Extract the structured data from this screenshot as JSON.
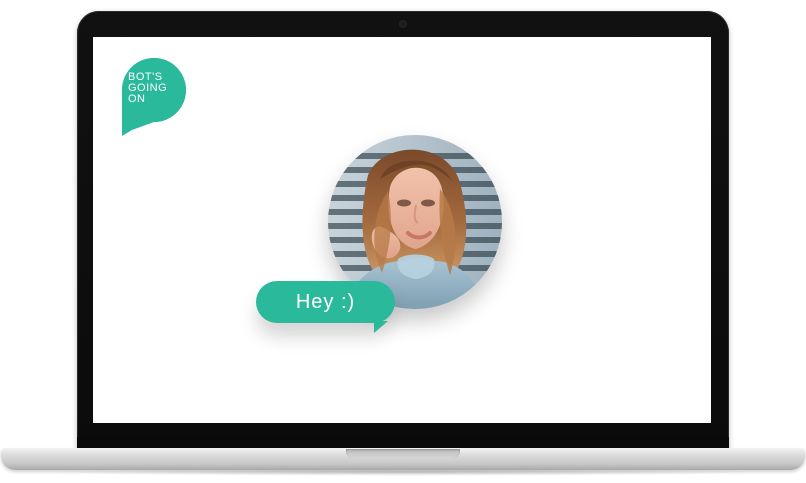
{
  "device": {
    "type": "laptop"
  },
  "logo": {
    "lines": [
      "BOT'S",
      "GOING",
      "ON"
    ],
    "accent_color": "#2bb99b"
  },
  "avatar": {
    "icon": "avatar-photo"
  },
  "chat": {
    "message": "Hey :)",
    "bubble_color": "#2bb99b",
    "text_color": "#ffffff"
  }
}
